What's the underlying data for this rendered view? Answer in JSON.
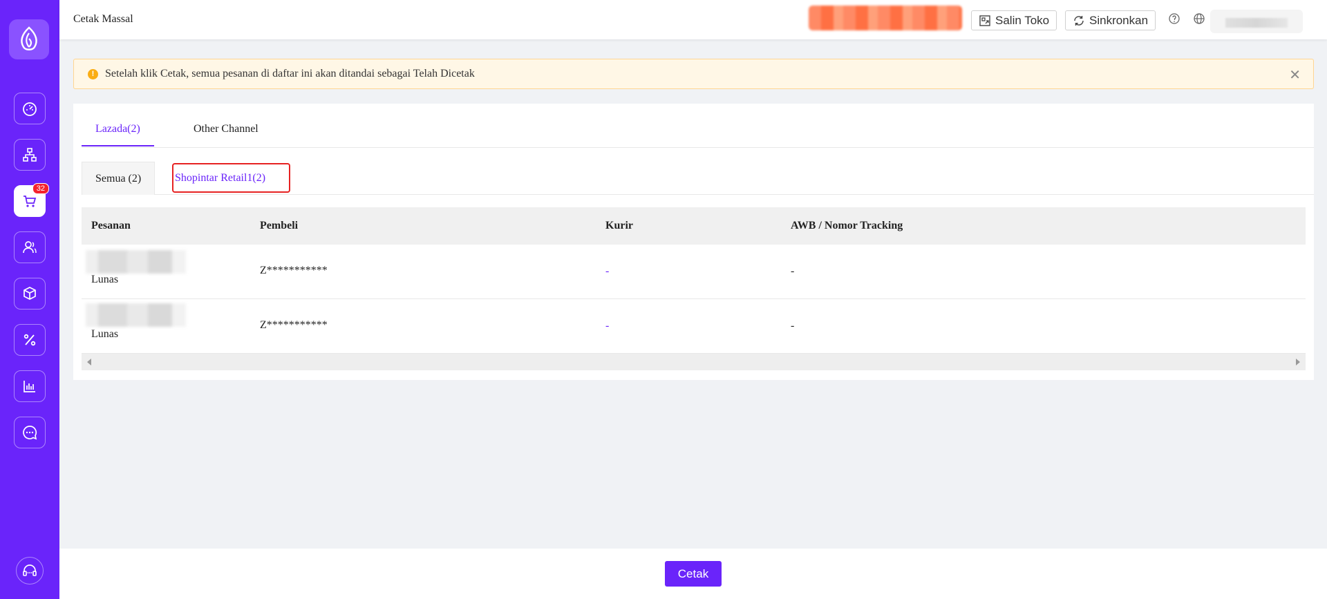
{
  "header": {
    "title": "Cetak Massal",
    "copy_shop_label": "Salin Toko",
    "sync_label": "Sinkronkan"
  },
  "sidebar": {
    "items": [
      {
        "icon": "dashboard-icon"
      },
      {
        "icon": "network-icon"
      },
      {
        "icon": "cart-icon",
        "badge": "32",
        "active": true
      },
      {
        "icon": "users-icon"
      },
      {
        "icon": "package-icon"
      },
      {
        "icon": "percent-icon"
      },
      {
        "icon": "chart-icon"
      },
      {
        "icon": "chat-icon"
      }
    ],
    "support_icon": "headset-icon"
  },
  "alert": {
    "text": "Setelah klik Cetak, semua pesanan di daftar ini akan ditandai sebagai Telah Dicetak"
  },
  "tabs": [
    {
      "label": "Lazada(2)",
      "active": true
    },
    {
      "label": "Other Channel",
      "active": false
    }
  ],
  "subtabs": [
    {
      "label": "Semua (2)"
    },
    {
      "label": "Shopintar Retail1(2)",
      "active": true
    }
  ],
  "table": {
    "columns": [
      "Pesanan",
      "Pembeli",
      "Kurir",
      "AWB / Nomor Tracking"
    ],
    "rows": [
      {
        "status": "Lunas",
        "buyer": "Z***********",
        "courier": "-",
        "awb": "-"
      },
      {
        "status": "Lunas",
        "buyer": "Z***********",
        "courier": "-",
        "awb": "-"
      }
    ]
  },
  "footer": {
    "print_label": "Cetak"
  },
  "colors": {
    "brand": "#6a24fa",
    "alert_bg": "#fff7e6",
    "highlight": "#e62222",
    "badge": "#f5222d"
  }
}
